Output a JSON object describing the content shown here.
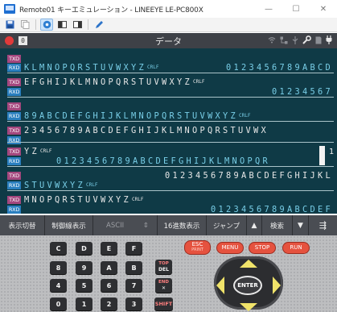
{
  "window": {
    "title": "Remote01 キーエミュレーション - LINEEYE LE-PC800X",
    "minimize": "—",
    "maximize": "☐",
    "close": "✕"
  },
  "toolbar": {
    "items": [
      {
        "name": "save-icon",
        "active": false
      },
      {
        "name": "copy-icon",
        "active": false
      },
      {
        "name": "monitor-icon",
        "active": true
      },
      {
        "name": "split-view-icon",
        "active": false
      },
      {
        "name": "single-view-icon",
        "active": false
      },
      {
        "name": "pen-icon",
        "active": false
      }
    ]
  },
  "data_header": {
    "channel": "0",
    "title": "データ",
    "icons": [
      "wifi-icon",
      "network-icon",
      "usb-icon",
      "wrench-icon",
      "sd-card-icon",
      "plug-icon"
    ]
  },
  "terminal": {
    "lines": [
      {
        "tag": "TXD",
        "text": "",
        "indent": 0
      },
      {
        "tag": "RXD",
        "text": "KLMNOPQRSTUVWXYZ",
        "cr": true,
        "indent": 0,
        "rightText": "0123456789ABCD"
      },
      {
        "tag": "TXD",
        "text": "EFGHIJKLMNOPQRSTUVWXYZ",
        "cr": true,
        "indent": 0
      },
      {
        "tag": "RXD",
        "text": "",
        "indent": 0,
        "rightText": "01234567"
      },
      {
        "tag": "TXD",
        "text": "",
        "indent": 0
      },
      {
        "tag": "RXD",
        "text": "89ABCDEFGHIJKLMNOPQRSTUVWXYZ",
        "cr": true,
        "indent": 0
      },
      {
        "tag": "TXD",
        "text": "23456789ABCDEFGHIJKLMNOPQRSTUVWX",
        "indent": 0
      },
      {
        "tag": "RXD",
        "text": "",
        "indent": 0
      },
      {
        "tag": "TXD",
        "text": "YZ",
        "cr": true,
        "indent": 0
      },
      {
        "tag": "RXD",
        "text": "0123456789ABCDEFGHIJKLMNOPQR",
        "indent": 1
      },
      {
        "tag": "TXD",
        "text": "",
        "indent": 0,
        "rightText": "0123456789ABCDEFGHIJKL"
      },
      {
        "tag": "RXD",
        "text": "STUVWXYZ",
        "cr": true,
        "indent": 0
      },
      {
        "tag": "TXD",
        "text": "MNOPQRSTUVWXYZ",
        "cr": true,
        "indent": 0
      },
      {
        "tag": "RXD",
        "text": "",
        "indent": 0,
        "rightText": "0123456789ABCDEF"
      }
    ],
    "cr_label": "CRLF",
    "cursor_number": "1"
  },
  "funcbar": {
    "display_toggle": "表示切替",
    "control_codes": "制御線表示",
    "encoding": "ASCII",
    "encoding_arrow": "⇕",
    "hex_display": "16進数表示",
    "jump": "ジャンプ",
    "jump_up": "▲",
    "search": "検索",
    "search_down": "▼",
    "menu_icon": "⇶"
  },
  "keypad": {
    "rows": [
      [
        "C",
        "D",
        "E",
        "F"
      ],
      [
        "8",
        "9",
        "A",
        "B"
      ],
      [
        "4",
        "5",
        "6",
        "7"
      ],
      [
        "0",
        "1",
        "2",
        "3"
      ]
    ],
    "fn_keys": [
      {
        "top": "TOP",
        "bottom": "DEL"
      },
      {
        "top": "END",
        "bottom": "✕"
      }
    ],
    "shift": "SHIFT",
    "esc": "ESC",
    "esc_sub": "PRINT",
    "menu": "MENU",
    "stop": "STOP",
    "run": "RUN",
    "enter": "ENTER"
  },
  "colors": {
    "terminal_bg": "#0f3a46",
    "txd_tag": "#a4477e",
    "rxd_tag": "#2a7fbf",
    "rx_text": "#79cfe8",
    "tx_text": "#e8e8e8",
    "accent_red": "#e5523f"
  }
}
